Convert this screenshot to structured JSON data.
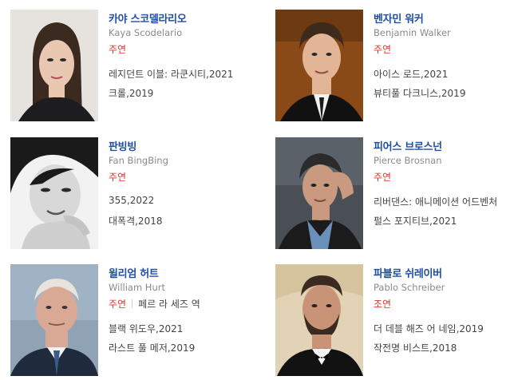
{
  "people": [
    {
      "name": "카야 스코델라리오",
      "name_en": "Kaya Scodelario",
      "role": "주연",
      "role_name": "",
      "works": [
        "레지던트 이블: 라쿤시티,2021",
        "크롤,2019"
      ],
      "colors": {
        "bg": "#e6e3df",
        "hair": "#3b2a20",
        "skin": "#e9c7b1",
        "cloth": "#1d1d1f"
      }
    },
    {
      "name": "벤자민 워커",
      "name_en": "Benjamin Walker",
      "role": "주연",
      "role_name": "",
      "works": [
        "아이스 로드,2021",
        "뷰티풀 다크니스,2019"
      ],
      "colors": {
        "bg": "#8a4a18",
        "hair": "#3d2a1b",
        "skin": "#e1b596",
        "cloth": "#111111"
      }
    },
    {
      "name": "판빙빙",
      "name_en": "Fan BingBing",
      "role": "주연",
      "role_name": "",
      "works": [
        "355,2022",
        "대폭격,2018"
      ],
      "colors": {
        "bg": "#f2f2f2",
        "hair": "#1a1a1a",
        "skin": "#d8d8d8",
        "cloth": "#cfcfcf"
      }
    },
    {
      "name": "피어스 브로스넌",
      "name_en": "Pierce Brosnan",
      "role": "주연",
      "role_name": "",
      "works": [
        "리버댄스: 애니메이션 어드벤처",
        "펄스 포지티브,2021"
      ],
      "colors": {
        "bg": "#4a4f55",
        "hair": "#2b2b2b",
        "skin": "#c99a7f",
        "cloth": "#6a8fb8"
      }
    },
    {
      "name": "윌리엄 허트",
      "name_en": "William Hurt",
      "role": "주연",
      "role_name": "페르 라 세즈 역",
      "works": [
        "블랙 위도우,2021",
        "라스트 풀 메저,2019"
      ],
      "colors": {
        "bg": "#8fa3b5",
        "hair": "#e8e3dc",
        "skin": "#d9a995",
        "cloth": "#1f2a3c"
      }
    },
    {
      "name": "파블로 쉬레이버",
      "name_en": "Pablo Schreiber",
      "role": "조연",
      "role_name": "",
      "works": [
        "더 데블 해즈 어 네임,2019",
        "작전명 비스트,2018"
      ],
      "colors": {
        "bg": "#e3d3b6",
        "hair": "#3a2a20",
        "skin": "#c99378",
        "cloth": "#121212"
      }
    }
  ]
}
